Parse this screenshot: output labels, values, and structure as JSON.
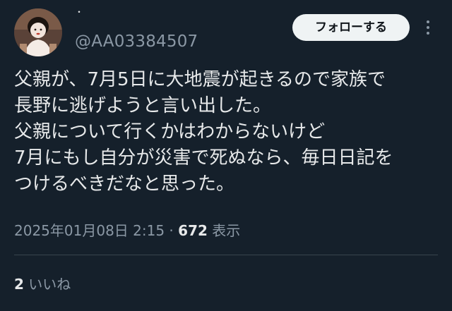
{
  "author": {
    "display_name": "・",
    "handle": "@AA03384507"
  },
  "actions": {
    "follow_label": "フォローする"
  },
  "icons": {
    "more": "more-vertical-icon",
    "avatar": "avatar-image"
  },
  "tweet": {
    "text": "父親が、7月5日に大地震が起きるので家族で\n長野に逃げようと言い出した。\n父親について行くかはわからないけど\n7月にもし自分が災害で死ぬなら、毎日日記を\nつけるべきだなと思った。",
    "timestamp": "2025年01月08日 2:15",
    "separator": " · ",
    "views_count": "672",
    "views_label": "表示"
  },
  "engagement": {
    "likes_count": "2",
    "likes_label": "いいね"
  },
  "colors": {
    "background": "#15202b",
    "text_primary": "#e7e9ea",
    "text_secondary": "#8b98a5",
    "button_bg": "#eff3f4",
    "divider": "#38444d"
  }
}
